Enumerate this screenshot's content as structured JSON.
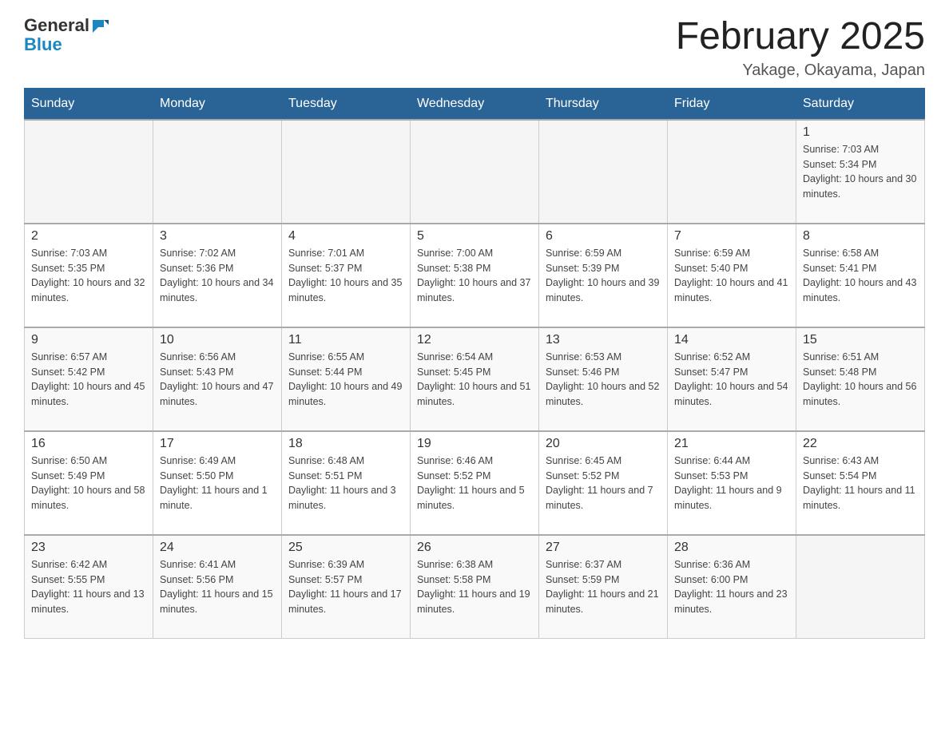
{
  "header": {
    "logo_general": "General",
    "logo_blue": "Blue",
    "month_year": "February 2025",
    "location": "Yakage, Okayama, Japan"
  },
  "weekdays": [
    "Sunday",
    "Monday",
    "Tuesday",
    "Wednesday",
    "Thursday",
    "Friday",
    "Saturday"
  ],
  "weeks": [
    [
      {
        "day": "",
        "sunrise": "",
        "sunset": "",
        "daylight": ""
      },
      {
        "day": "",
        "sunrise": "",
        "sunset": "",
        "daylight": ""
      },
      {
        "day": "",
        "sunrise": "",
        "sunset": "",
        "daylight": ""
      },
      {
        "day": "",
        "sunrise": "",
        "sunset": "",
        "daylight": ""
      },
      {
        "day": "",
        "sunrise": "",
        "sunset": "",
        "daylight": ""
      },
      {
        "day": "",
        "sunrise": "",
        "sunset": "",
        "daylight": ""
      },
      {
        "day": "1",
        "sunrise": "Sunrise: 7:03 AM",
        "sunset": "Sunset: 5:34 PM",
        "daylight": "Daylight: 10 hours and 30 minutes."
      }
    ],
    [
      {
        "day": "2",
        "sunrise": "Sunrise: 7:03 AM",
        "sunset": "Sunset: 5:35 PM",
        "daylight": "Daylight: 10 hours and 32 minutes."
      },
      {
        "day": "3",
        "sunrise": "Sunrise: 7:02 AM",
        "sunset": "Sunset: 5:36 PM",
        "daylight": "Daylight: 10 hours and 34 minutes."
      },
      {
        "day": "4",
        "sunrise": "Sunrise: 7:01 AM",
        "sunset": "Sunset: 5:37 PM",
        "daylight": "Daylight: 10 hours and 35 minutes."
      },
      {
        "day": "5",
        "sunrise": "Sunrise: 7:00 AM",
        "sunset": "Sunset: 5:38 PM",
        "daylight": "Daylight: 10 hours and 37 minutes."
      },
      {
        "day": "6",
        "sunrise": "Sunrise: 6:59 AM",
        "sunset": "Sunset: 5:39 PM",
        "daylight": "Daylight: 10 hours and 39 minutes."
      },
      {
        "day": "7",
        "sunrise": "Sunrise: 6:59 AM",
        "sunset": "Sunset: 5:40 PM",
        "daylight": "Daylight: 10 hours and 41 minutes."
      },
      {
        "day": "8",
        "sunrise": "Sunrise: 6:58 AM",
        "sunset": "Sunset: 5:41 PM",
        "daylight": "Daylight: 10 hours and 43 minutes."
      }
    ],
    [
      {
        "day": "9",
        "sunrise": "Sunrise: 6:57 AM",
        "sunset": "Sunset: 5:42 PM",
        "daylight": "Daylight: 10 hours and 45 minutes."
      },
      {
        "day": "10",
        "sunrise": "Sunrise: 6:56 AM",
        "sunset": "Sunset: 5:43 PM",
        "daylight": "Daylight: 10 hours and 47 minutes."
      },
      {
        "day": "11",
        "sunrise": "Sunrise: 6:55 AM",
        "sunset": "Sunset: 5:44 PM",
        "daylight": "Daylight: 10 hours and 49 minutes."
      },
      {
        "day": "12",
        "sunrise": "Sunrise: 6:54 AM",
        "sunset": "Sunset: 5:45 PM",
        "daylight": "Daylight: 10 hours and 51 minutes."
      },
      {
        "day": "13",
        "sunrise": "Sunrise: 6:53 AM",
        "sunset": "Sunset: 5:46 PM",
        "daylight": "Daylight: 10 hours and 52 minutes."
      },
      {
        "day": "14",
        "sunrise": "Sunrise: 6:52 AM",
        "sunset": "Sunset: 5:47 PM",
        "daylight": "Daylight: 10 hours and 54 minutes."
      },
      {
        "day": "15",
        "sunrise": "Sunrise: 6:51 AM",
        "sunset": "Sunset: 5:48 PM",
        "daylight": "Daylight: 10 hours and 56 minutes."
      }
    ],
    [
      {
        "day": "16",
        "sunrise": "Sunrise: 6:50 AM",
        "sunset": "Sunset: 5:49 PM",
        "daylight": "Daylight: 10 hours and 58 minutes."
      },
      {
        "day": "17",
        "sunrise": "Sunrise: 6:49 AM",
        "sunset": "Sunset: 5:50 PM",
        "daylight": "Daylight: 11 hours and 1 minute."
      },
      {
        "day": "18",
        "sunrise": "Sunrise: 6:48 AM",
        "sunset": "Sunset: 5:51 PM",
        "daylight": "Daylight: 11 hours and 3 minutes."
      },
      {
        "day": "19",
        "sunrise": "Sunrise: 6:46 AM",
        "sunset": "Sunset: 5:52 PM",
        "daylight": "Daylight: 11 hours and 5 minutes."
      },
      {
        "day": "20",
        "sunrise": "Sunrise: 6:45 AM",
        "sunset": "Sunset: 5:52 PM",
        "daylight": "Daylight: 11 hours and 7 minutes."
      },
      {
        "day": "21",
        "sunrise": "Sunrise: 6:44 AM",
        "sunset": "Sunset: 5:53 PM",
        "daylight": "Daylight: 11 hours and 9 minutes."
      },
      {
        "day": "22",
        "sunrise": "Sunrise: 6:43 AM",
        "sunset": "Sunset: 5:54 PM",
        "daylight": "Daylight: 11 hours and 11 minutes."
      }
    ],
    [
      {
        "day": "23",
        "sunrise": "Sunrise: 6:42 AM",
        "sunset": "Sunset: 5:55 PM",
        "daylight": "Daylight: 11 hours and 13 minutes."
      },
      {
        "day": "24",
        "sunrise": "Sunrise: 6:41 AM",
        "sunset": "Sunset: 5:56 PM",
        "daylight": "Daylight: 11 hours and 15 minutes."
      },
      {
        "day": "25",
        "sunrise": "Sunrise: 6:39 AM",
        "sunset": "Sunset: 5:57 PM",
        "daylight": "Daylight: 11 hours and 17 minutes."
      },
      {
        "day": "26",
        "sunrise": "Sunrise: 6:38 AM",
        "sunset": "Sunset: 5:58 PM",
        "daylight": "Daylight: 11 hours and 19 minutes."
      },
      {
        "day": "27",
        "sunrise": "Sunrise: 6:37 AM",
        "sunset": "Sunset: 5:59 PM",
        "daylight": "Daylight: 11 hours and 21 minutes."
      },
      {
        "day": "28",
        "sunrise": "Sunrise: 6:36 AM",
        "sunset": "Sunset: 6:00 PM",
        "daylight": "Daylight: 11 hours and 23 minutes."
      },
      {
        "day": "",
        "sunrise": "",
        "sunset": "",
        "daylight": ""
      }
    ]
  ]
}
